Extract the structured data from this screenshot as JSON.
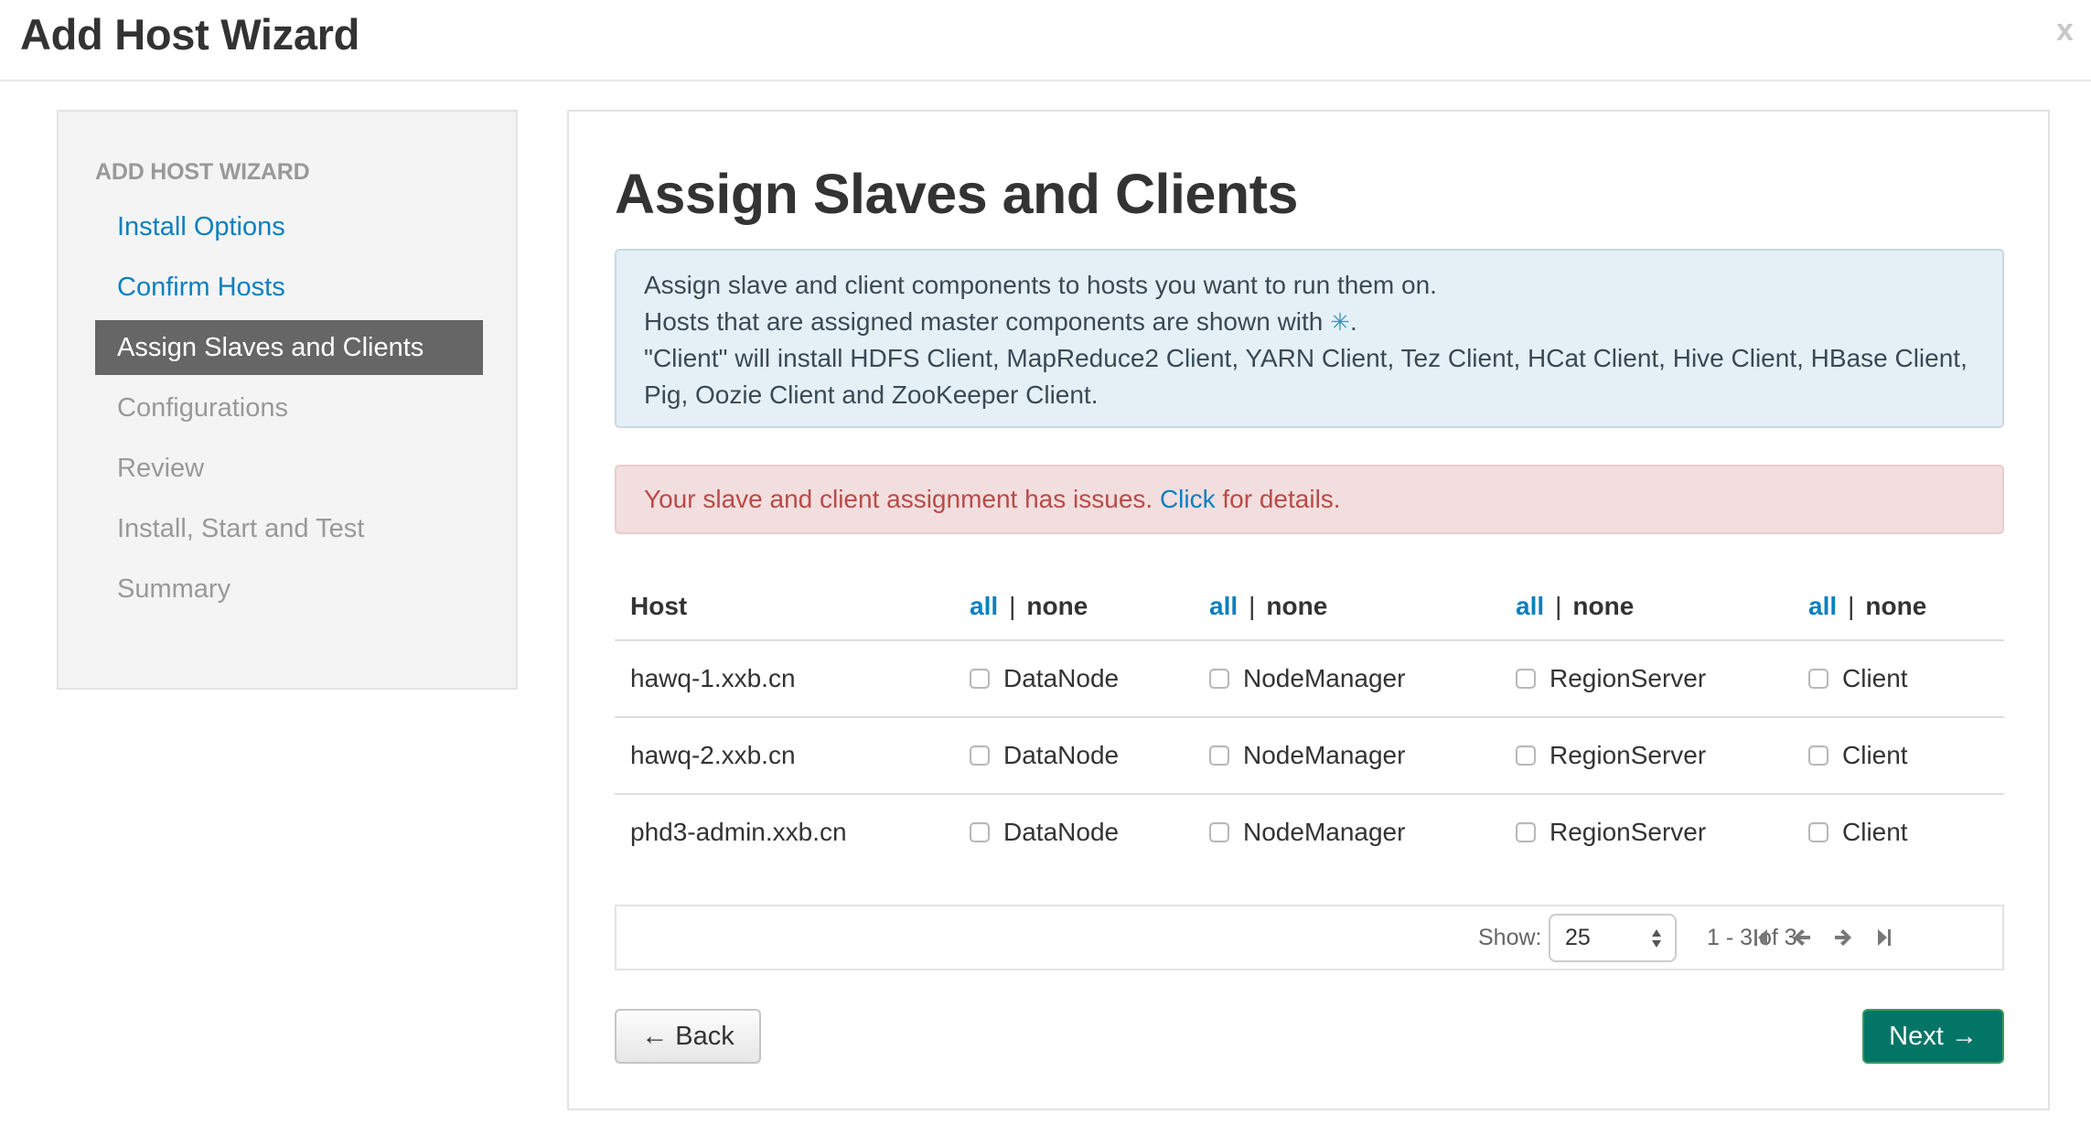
{
  "modal": {
    "title": "Add Host Wizard",
    "close_label": "x"
  },
  "sidebar": {
    "header": "ADD HOST WIZARD",
    "items": [
      {
        "label": "Install Options",
        "state": "done"
      },
      {
        "label": "Confirm Hosts",
        "state": "done"
      },
      {
        "label": "Assign Slaves and Clients",
        "state": "active"
      },
      {
        "label": "Configurations",
        "state": "future"
      },
      {
        "label": "Review",
        "state": "future"
      },
      {
        "label": "Install, Start and Test",
        "state": "future"
      },
      {
        "label": "Summary",
        "state": "future"
      }
    ]
  },
  "main": {
    "title": "Assign Slaves and Clients",
    "info": {
      "line1": "Assign slave and client components to hosts you want to run them on.",
      "line2_prefix": "Hosts that are assigned master components are shown with ",
      "line2_icon": "✳",
      "line2_suffix": ".",
      "line3": "\"Client\" will install HDFS Client, MapReduce2 Client, YARN Client, Tez Client, HCat Client, Hive Client, HBase Client, Pig, Oozie Client and ZooKeeper Client."
    },
    "error": {
      "prefix": "Your slave and client assignment has issues. ",
      "link": "Click",
      "suffix": " for details."
    },
    "table": {
      "host_header": "Host",
      "select_all": "all",
      "separator": "|",
      "select_none": "none",
      "rows": [
        {
          "host": "hawq-1.xxb.cn",
          "components": [
            {
              "label": "DataNode",
              "checked": false
            },
            {
              "label": "NodeManager",
              "checked": false
            },
            {
              "label": "RegionServer",
              "checked": false
            },
            {
              "label": "Client",
              "checked": false
            }
          ]
        },
        {
          "host": "hawq-2.xxb.cn",
          "components": [
            {
              "label": "DataNode",
              "checked": false
            },
            {
              "label": "NodeManager",
              "checked": false
            },
            {
              "label": "RegionServer",
              "checked": false
            },
            {
              "label": "Client",
              "checked": false
            }
          ]
        },
        {
          "host": "phd3-admin.xxb.cn",
          "components": [
            {
              "label": "DataNode",
              "checked": false
            },
            {
              "label": "NodeManager",
              "checked": false
            },
            {
              "label": "RegionServer",
              "checked": false
            },
            {
              "label": "Client",
              "checked": false
            }
          ]
        }
      ]
    },
    "pagination": {
      "show_label": "Show:",
      "page_size": "25",
      "range": "1 - 3 of 3",
      "icons": [
        "first-page-icon",
        "previous-page-icon",
        "next-page-icon",
        "last-page-icon"
      ]
    },
    "buttons": {
      "back": "← Back",
      "next": "Next →"
    }
  },
  "colors": {
    "link": "#0a80c0",
    "active_nav": "#666666",
    "info_bg": "#e5f0f6",
    "error_bg": "#f2dede",
    "error_text": "#b94a48",
    "next_button": "#037566"
  }
}
